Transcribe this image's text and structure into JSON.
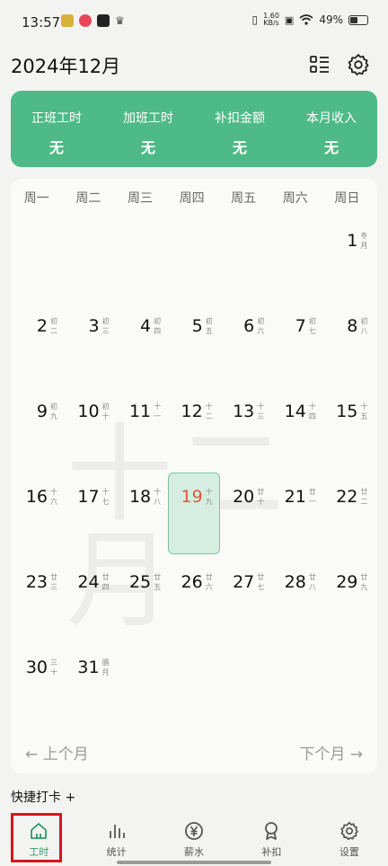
{
  "status_bar": {
    "time": "13:57",
    "net_speed": "1.60",
    "net_unit": "KB/s",
    "battery": "49%",
    "battery_level": 0.49
  },
  "header": {
    "title": "2024年12月"
  },
  "summary": [
    {
      "label": "正班工时",
      "value": "无"
    },
    {
      "label": "加班工时",
      "value": "无"
    },
    {
      "label": "补扣金额",
      "value": "无"
    },
    {
      "label": "本月收入",
      "value": "无"
    }
  ],
  "calendar": {
    "weekdays": [
      "周一",
      "周二",
      "周三",
      "周四",
      "周五",
      "周六",
      "周日"
    ],
    "watermark": "十二月",
    "today": "19",
    "weeks": [
      [
        null,
        null,
        null,
        null,
        null,
        null,
        {
          "day": "1",
          "lunar": "冬月"
        }
      ],
      [
        {
          "day": "2",
          "lunar": "初二"
        },
        {
          "day": "3",
          "lunar": "初三"
        },
        {
          "day": "4",
          "lunar": "初四"
        },
        {
          "day": "5",
          "lunar": "初五"
        },
        {
          "day": "6",
          "lunar": "初六"
        },
        {
          "day": "7",
          "lunar": "初七"
        },
        {
          "day": "8",
          "lunar": "初八"
        }
      ],
      [
        {
          "day": "9",
          "lunar": "初九"
        },
        {
          "day": "10",
          "lunar": "初十"
        },
        {
          "day": "11",
          "lunar": "十一"
        },
        {
          "day": "12",
          "lunar": "十二"
        },
        {
          "day": "13",
          "lunar": "十三"
        },
        {
          "day": "14",
          "lunar": "十四"
        },
        {
          "day": "15",
          "lunar": "十五"
        }
      ],
      [
        {
          "day": "16",
          "lunar": "十六"
        },
        {
          "day": "17",
          "lunar": "十七"
        },
        {
          "day": "18",
          "lunar": "十八"
        },
        {
          "day": "19",
          "lunar": "十九"
        },
        {
          "day": "20",
          "lunar": "廿十"
        },
        {
          "day": "21",
          "lunar": "廿一"
        },
        {
          "day": "22",
          "lunar": "廿二"
        }
      ],
      [
        {
          "day": "23",
          "lunar": "廿三"
        },
        {
          "day": "24",
          "lunar": "廿四"
        },
        {
          "day": "25",
          "lunar": "廿五"
        },
        {
          "day": "26",
          "lunar": "廿六"
        },
        {
          "day": "27",
          "lunar": "廿七"
        },
        {
          "day": "28",
          "lunar": "廿八"
        },
        {
          "day": "29",
          "lunar": "廿九"
        }
      ],
      [
        {
          "day": "30",
          "lunar": "三十"
        },
        {
          "day": "31",
          "lunar": "腊月"
        },
        null,
        null,
        null,
        null,
        null
      ]
    ],
    "prev_label": "← 上个月",
    "next_label": "下个月 →"
  },
  "quick_punch": "快捷打卡 +",
  "tabs": [
    {
      "label": "工时",
      "icon": "home-icon",
      "active": true
    },
    {
      "label": "统计",
      "icon": "bar-chart-icon",
      "active": false
    },
    {
      "label": "薪水",
      "icon": "yen-coin-icon",
      "active": false
    },
    {
      "label": "补扣",
      "icon": "award-icon",
      "active": false
    },
    {
      "label": "设置",
      "icon": "gear-icon",
      "active": false
    }
  ],
  "colors": {
    "accent": "#4dba87",
    "today": "#e2533a",
    "highlight_box": "#d9141b"
  }
}
